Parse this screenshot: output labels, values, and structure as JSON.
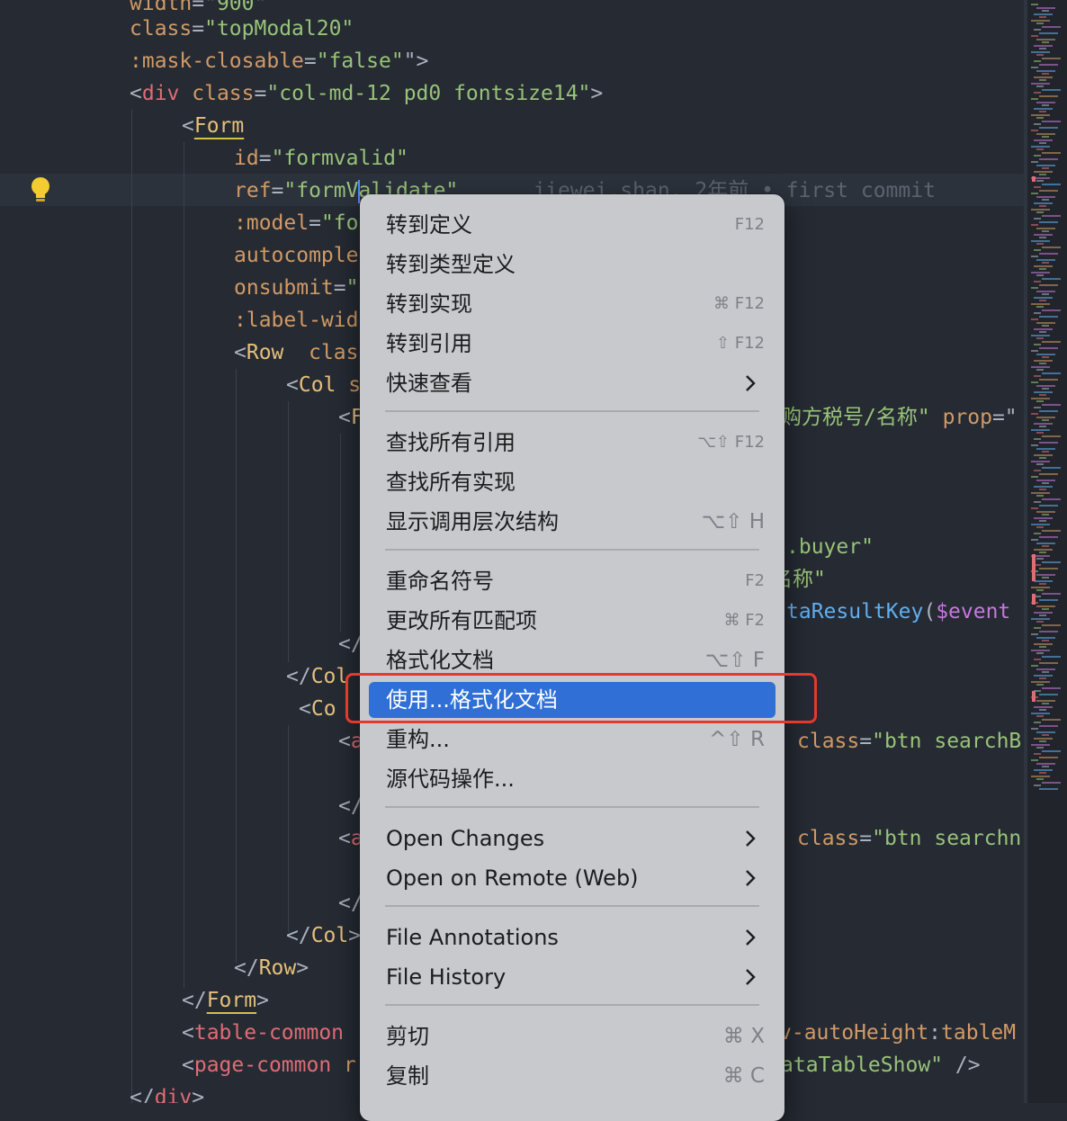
{
  "editor": {
    "lines": [
      {
        "tokens": [
          [
            "attr",
            "width"
          ],
          [
            "punc",
            "="
          ],
          [
            "str",
            "\"900\""
          ]
        ]
      },
      {
        "tokens": [
          [
            "attr",
            "class"
          ],
          [
            "punc",
            "="
          ],
          [
            "str",
            "\"topModal20\""
          ]
        ]
      },
      {
        "tokens": [
          [
            "attr",
            ":mask-closable"
          ],
          [
            "punc",
            "="
          ],
          [
            "str",
            "\"false\""
          ],
          [
            "punc",
            "\">"
          ]
        ]
      },
      {
        "tokens": [
          [
            "punc",
            "<"
          ],
          [
            "tag",
            "div"
          ],
          [
            "punc",
            " "
          ],
          [
            "attr",
            "class"
          ],
          [
            "punc",
            "="
          ],
          [
            "str",
            "\"col-md-12 pd0 fontsize14\""
          ],
          [
            "punc",
            ">"
          ]
        ]
      },
      {
        "tokens": [
          [
            "punc",
            "<"
          ],
          [
            "comp",
            "Form"
          ]
        ]
      },
      {
        "tokens": [
          [
            "attr",
            "id"
          ],
          [
            "punc",
            "="
          ],
          [
            "str",
            "\"formvalid\""
          ]
        ]
      },
      {
        "tokens": [
          [
            "attr",
            "ref"
          ],
          [
            "punc",
            "="
          ],
          [
            "str",
            "\"formValidate\""
          ],
          [
            "blame",
            "      jiewei.shan, 2年前 • first commit"
          ]
        ]
      },
      {
        "tokens": [
          [
            "attr",
            ":model"
          ],
          [
            "punc",
            "="
          ],
          [
            "str",
            "\"fo"
          ]
        ]
      },
      {
        "tokens": [
          [
            "attr",
            "autocomple"
          ]
        ]
      },
      {
        "tokens": [
          [
            "attr",
            "onsubmit"
          ],
          [
            "punc",
            "="
          ],
          [
            "str",
            "\""
          ]
        ]
      },
      {
        "tokens": [
          [
            "attr",
            ":label-wid"
          ]
        ]
      },
      {
        "tokens": [
          [
            "punc",
            "<"
          ],
          [
            "comp",
            "Row"
          ],
          [
            "punc",
            "  "
          ],
          [
            "attr",
            "clas"
          ]
        ]
      },
      {
        "tokens": [
          [
            "punc",
            "<"
          ],
          [
            "comp",
            "Col"
          ],
          [
            "punc",
            " "
          ],
          [
            "attr",
            "s"
          ]
        ]
      },
      {
        "tokens": [
          [
            "punc",
            "<"
          ],
          [
            "comp",
            "F"
          ]
        ]
      },
      {
        "tokens": [
          [
            "punc",
            "</"
          ]
        ]
      },
      {
        "tokens": [
          [
            "punc",
            "</"
          ],
          [
            "comp",
            "Col"
          ]
        ]
      },
      {
        "tokens": [
          [
            "punc",
            "<"
          ],
          [
            "comp",
            "Co"
          ]
        ]
      },
      {
        "tokens": [
          [
            "punc",
            "<"
          ],
          [
            "tag",
            "a"
          ]
        ]
      },
      {
        "tokens": [
          [
            "punc",
            "</"
          ]
        ]
      },
      {
        "tokens": [
          [
            "punc",
            "<"
          ],
          [
            "tag",
            "a"
          ]
        ]
      },
      {
        "tokens": [
          [
            "punc",
            "</"
          ]
        ]
      },
      {
        "tokens": [
          [
            "punc",
            "</"
          ],
          [
            "comp",
            "Col"
          ],
          [
            "punc",
            ">"
          ]
        ]
      },
      {
        "tokens": [
          [
            "punc",
            "</"
          ],
          [
            "comp",
            "Row"
          ],
          [
            "punc",
            ">"
          ]
        ]
      },
      {
        "tokens": [
          [
            "punc",
            "</"
          ],
          [
            "comp",
            "Form"
          ],
          [
            "punc",
            ">"
          ]
        ]
      },
      {
        "tokens": [
          [
            "punc",
            "<"
          ],
          [
            "tag",
            "table-common"
          ],
          [
            "punc",
            " "
          ]
        ]
      },
      {
        "tokens": [
          [
            "punc",
            "<"
          ],
          [
            "tag",
            "page-common"
          ],
          [
            "punc",
            " "
          ],
          [
            "attr",
            "r"
          ]
        ]
      },
      {
        "tokens": [
          [
            "punc",
            "</"
          ],
          [
            "tag",
            "div"
          ],
          [
            "punc",
            ">"
          ]
        ]
      }
    ],
    "right_fragments": [
      {
        "tokens": [
          [
            "str",
            "购方税号/名称\""
          ],
          [
            "punc",
            " "
          ],
          [
            "attr",
            "prop"
          ],
          [
            "punc",
            "=\""
          ]
        ]
      },
      {
        "tokens": [
          [
            "str",
            ".buyer\""
          ]
        ]
      },
      {
        "tokens": [
          [
            "str",
            "名称\""
          ]
        ]
      },
      {
        "tokens": [
          [
            "fn",
            "taResultKey"
          ],
          [
            "punc",
            "("
          ],
          [
            "var",
            "$event"
          ]
        ]
      },
      {
        "tokens": [
          [
            "attr",
            "class"
          ],
          [
            "punc",
            "="
          ],
          [
            "str",
            "\"btn searchB"
          ]
        ]
      },
      {
        "tokens": [
          [
            "attr",
            "class"
          ],
          [
            "punc",
            "="
          ],
          [
            "str",
            "\"btn searchn"
          ]
        ]
      },
      {
        "tokens": [
          [
            "attr",
            "v-autoHeight"
          ],
          [
            "punc",
            ":"
          ],
          [
            "attr",
            "tableM"
          ]
        ]
      },
      {
        "tokens": [
          [
            "str",
            "ataTableShow\""
          ],
          [
            "punc",
            " />"
          ]
        ]
      }
    ]
  },
  "context_menu": {
    "items": [
      {
        "label": "转到定义",
        "shortcut": "F12"
      },
      {
        "label": "转到类型定义",
        "shortcut": ""
      },
      {
        "label": "转到实现",
        "shortcut": "⌘ F12"
      },
      {
        "label": "转到引用",
        "shortcut": "⇧ F12"
      },
      {
        "label": "快速查看",
        "submenu": true
      },
      {
        "label": "查找所有引用",
        "shortcut": "⌥⇧ F12"
      },
      {
        "label": "查找所有实现",
        "shortcut": ""
      },
      {
        "label": "显示调用层次结构",
        "shortcut": "⌥⇧ H"
      },
      {
        "label": "重命名符号",
        "shortcut": "F2"
      },
      {
        "label": "更改所有匹配项",
        "shortcut": "⌘ F2"
      },
      {
        "label": "格式化文档",
        "shortcut": "⌥⇧ F"
      },
      {
        "label": "使用...格式化文档",
        "shortcut": "",
        "highlighted": true
      },
      {
        "label": "重构...",
        "shortcut": "^⇧ R"
      },
      {
        "label": "源代码操作...",
        "shortcut": ""
      },
      {
        "label": "Open Changes",
        "submenu": true
      },
      {
        "label": "Open on Remote (Web)",
        "submenu": true
      },
      {
        "label": "File Annotations",
        "submenu": true
      },
      {
        "label": "File History",
        "submenu": true
      },
      {
        "label": "剪切",
        "shortcut": "⌘ X"
      },
      {
        "label": "复制",
        "shortcut": "⌘ C"
      }
    ]
  },
  "colors": {
    "highlight": "#2f6fd6",
    "annotation_box": "#e33a2c",
    "editor_bg": "#252a33"
  }
}
